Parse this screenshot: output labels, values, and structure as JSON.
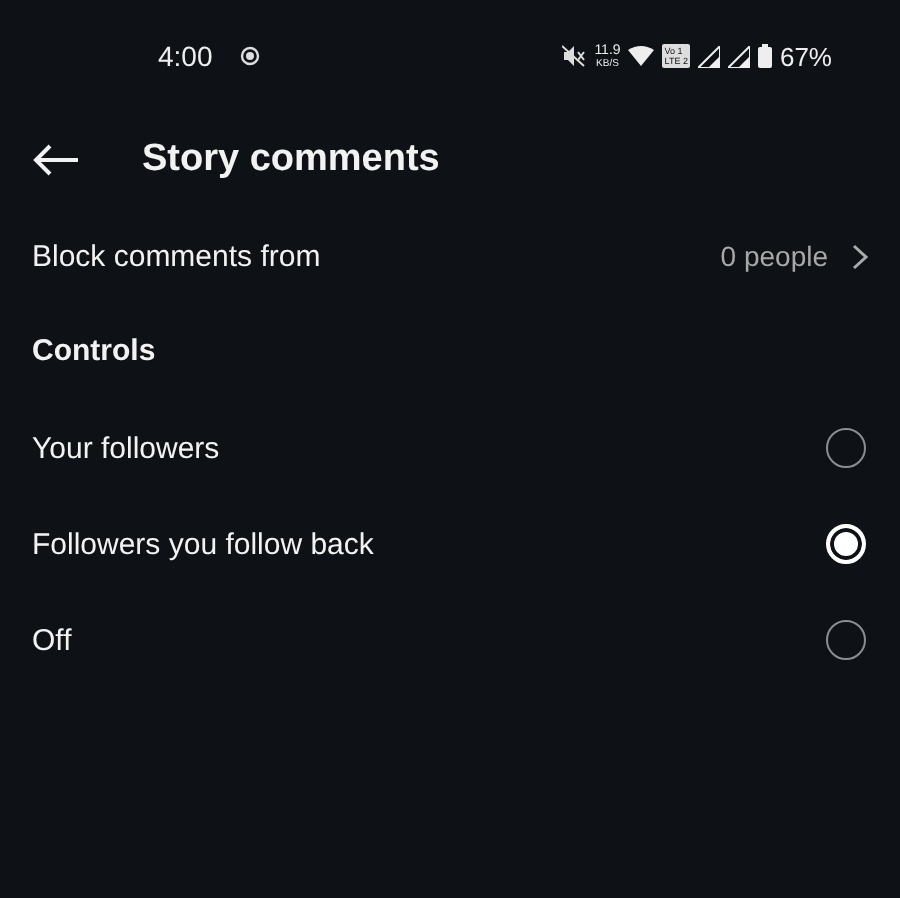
{
  "status_bar": {
    "time": "4:00",
    "speed_value": "11.9",
    "speed_unit": "KB/S",
    "sim_top": "Vo 1",
    "sim_bottom": "LTE 2",
    "battery": "67%"
  },
  "header": {
    "title": "Story comments"
  },
  "block_row": {
    "label": "Block comments from",
    "value": "0 people"
  },
  "section": {
    "title": "Controls"
  },
  "options": [
    {
      "label": "Your followers",
      "selected": false
    },
    {
      "label": "Followers you follow back",
      "selected": true
    },
    {
      "label": "Off",
      "selected": false
    }
  ]
}
